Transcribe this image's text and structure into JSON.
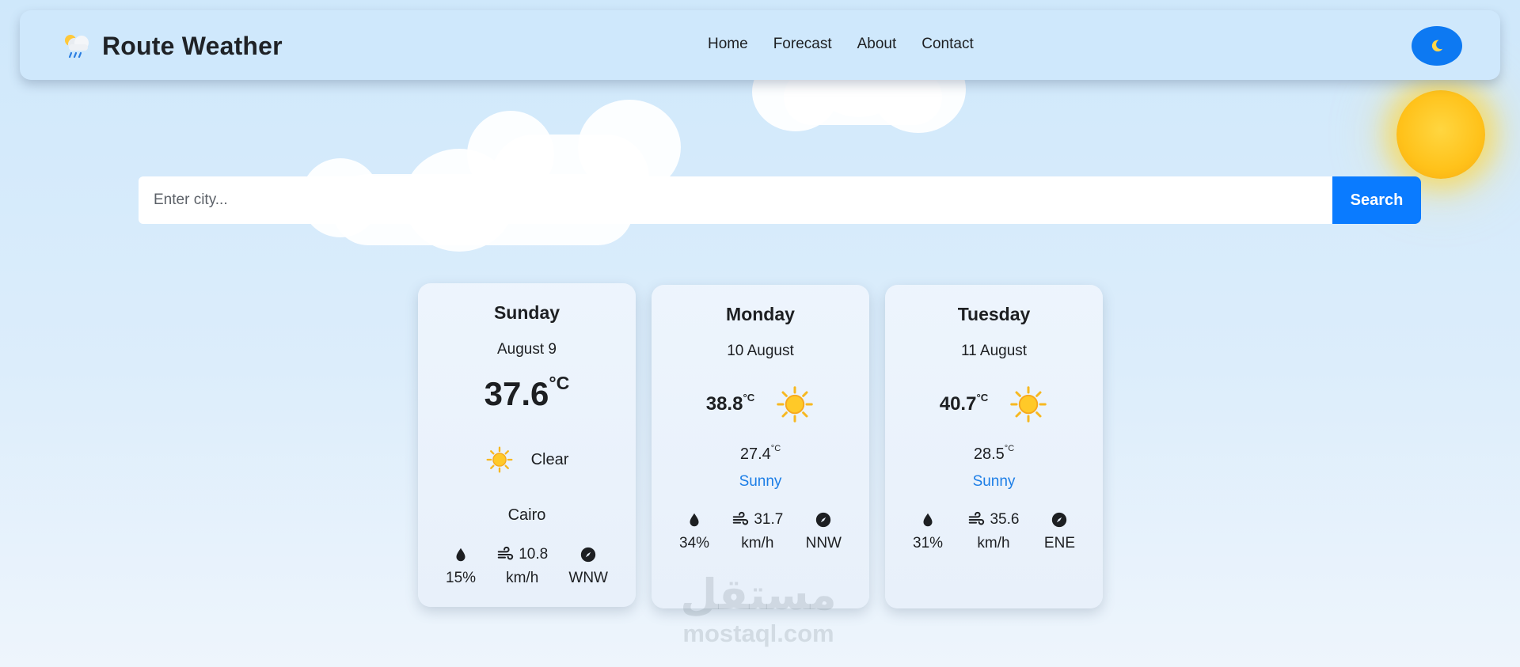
{
  "brand": {
    "title": "Route Weather",
    "icon": "rain-cloud-icon"
  },
  "nav": {
    "links": [
      "Home",
      "Forecast",
      "About",
      "Contact"
    ],
    "theme_toggle_icon": "moon-icon"
  },
  "search": {
    "placeholder": "Enter city...",
    "button_label": "Search"
  },
  "today": {
    "day": "Sunday",
    "date": "August 9",
    "temp": "37.6",
    "unit": "°C",
    "condition": "Clear",
    "condition_icon": "sun-icon",
    "city": "Cairo",
    "humidity": "15%",
    "wind_value": "10.8",
    "wind_unit": "km/h",
    "direction": "WNW"
  },
  "forecast": [
    {
      "day": "Monday",
      "date": "10 August",
      "max_temp": "38.8",
      "min_temp": "27.4",
      "unit": "°C",
      "condition": "Sunny",
      "condition_icon": "sun-icon",
      "humidity": "34%",
      "wind_value": "31.7",
      "wind_unit": "km/h",
      "direction": "NNW"
    },
    {
      "day": "Tuesday",
      "date": "11 August",
      "max_temp": "40.7",
      "min_temp": "28.5",
      "unit": "°C",
      "condition": "Sunny",
      "condition_icon": "sun-icon",
      "humidity": "31%",
      "wind_value": "35.6",
      "wind_unit": "km/h",
      "direction": "ENE"
    }
  ],
  "watermark": {
    "mark": "مستقل",
    "text": "mostaql.com"
  },
  "colors": {
    "accent": "#0a7bff",
    "condition_link": "#1c7ee6",
    "sun": "#ffc21a"
  }
}
